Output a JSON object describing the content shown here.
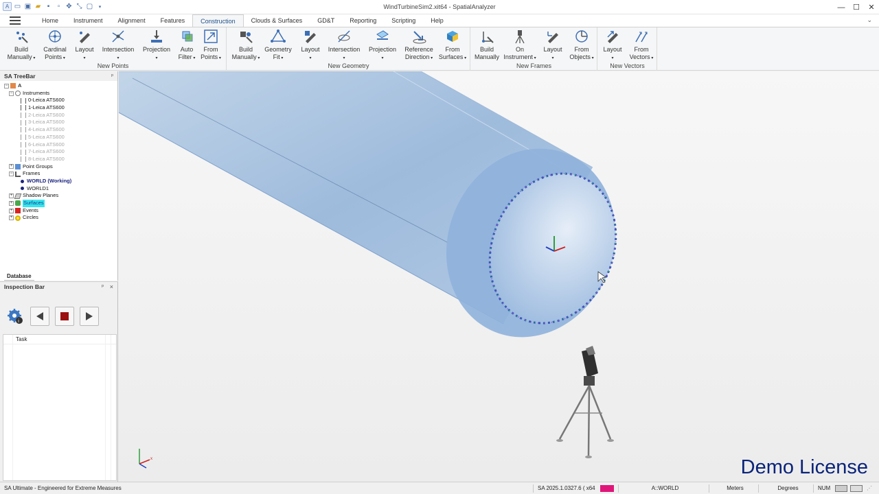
{
  "window": {
    "title": "WindTurbineSim2.xit64 - SpatialAnalyzer",
    "controls": [
      "minimize",
      "maximize",
      "close"
    ]
  },
  "tabs": [
    "Home",
    "Instrument",
    "Alignment",
    "Features",
    "Construction",
    "Clouds & Surfaces",
    "GD&T",
    "Reporting",
    "Scripting",
    "Help"
  ],
  "active_tab": "Construction",
  "ribbon": {
    "new_points": {
      "label": "New Points",
      "buttons": [
        "Build Manually",
        "Cardinal Points",
        "Layout",
        "Intersection",
        "Projection",
        "Auto Filter",
        "From Points"
      ]
    },
    "new_geometry": {
      "label": "New Geometry",
      "buttons": [
        "Build Manually",
        "Geometry Fit",
        "Layout",
        "Intersection",
        "Projection",
        "Reference Direction",
        "From Surfaces"
      ]
    },
    "new_frames": {
      "label": "New Frames",
      "buttons": [
        "Build Manually",
        "On Instrument",
        "Layout",
        "From Objects"
      ]
    },
    "new_vectors": {
      "label": "New Vectors",
      "buttons": [
        "Layout",
        "From Vectors"
      ]
    }
  },
  "treebar": {
    "title": "SA TreeBar",
    "pin": "ᵖ",
    "root": "A",
    "instruments_label": "Instruments",
    "instruments": [
      {
        "label": "0-Leica ATS600",
        "active": true
      },
      {
        "label": "1-Leica ATS600",
        "active": true
      },
      {
        "label": "2-Leica ATS600",
        "active": false
      },
      {
        "label": "3-Leica ATS600",
        "active": false
      },
      {
        "label": "4-Leica ATS600",
        "active": false
      },
      {
        "label": "5-Leica ATS600",
        "active": false
      },
      {
        "label": "6-Leica ATS600",
        "active": false
      },
      {
        "label": "7-Leica ATS600",
        "active": false
      },
      {
        "label": "8-Leica ATS600",
        "active": false
      }
    ],
    "point_groups": "Point Groups",
    "frames": "Frames",
    "frame_working": "WORLD (Working)",
    "frame_world1": "WORLD1",
    "shadow_planes": "Shadow Planes",
    "surfaces": "Surfaces",
    "events": "Events",
    "circles": "Circles",
    "database_tab": "Database"
  },
  "inspection_bar": {
    "title": "Inspection Bar",
    "pin": "ᵖ",
    "close": "×",
    "task_header": "Task"
  },
  "viewport": {
    "watermark": "Demo License"
  },
  "statusbar": {
    "left": "SA Ultimate - Engineered for Extreme Measures",
    "version": "SA 2025.1.0327.6 ( x64 )",
    "frame": "A::WORLD",
    "units": "Meters",
    "angles": "Degrees",
    "num": "NUM",
    "accent_color": "#e0157a"
  }
}
